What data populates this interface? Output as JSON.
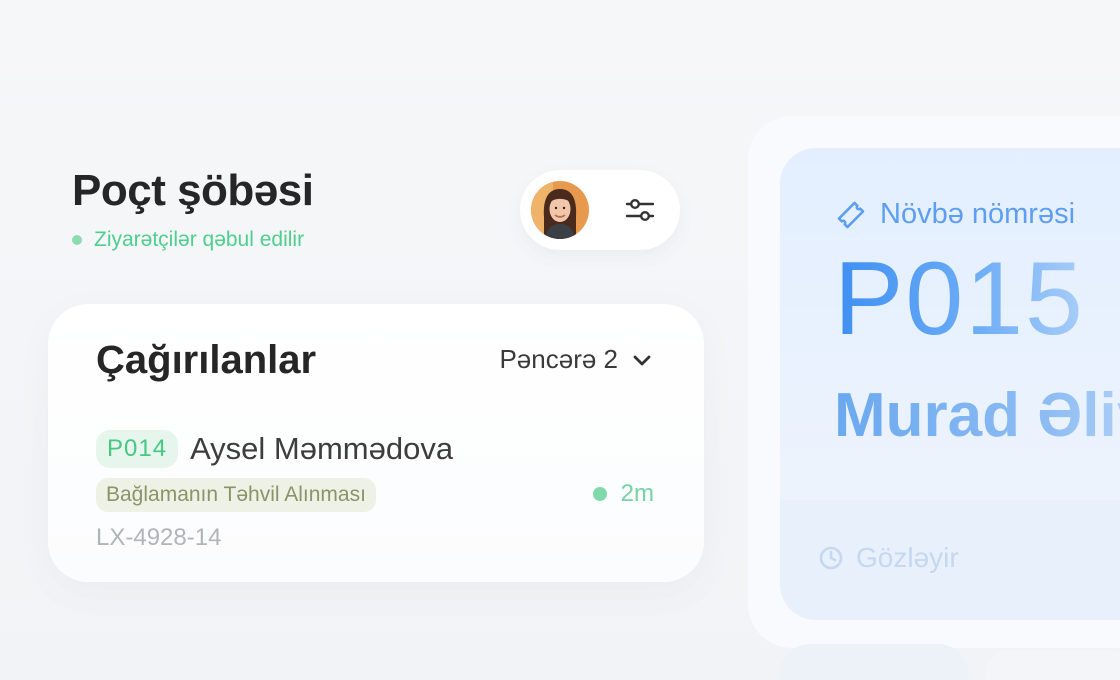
{
  "header": {
    "title": "Poçt şöbəsi",
    "status": "Ziyarətçilər qəbul edilir"
  },
  "profile": {
    "avatar_icon": "avatar",
    "filter_icon": "sliders-icon"
  },
  "called": {
    "title": "Çağırılanlar",
    "window": "Pəncərə 2",
    "ticket": {
      "number": "P014",
      "name": "Aysel Məmmədova",
      "service": "Bağlamanın Təhvil Alınması",
      "code": "LX-4928-14",
      "time": "2m"
    }
  },
  "queue": {
    "label": "Növbə nömrəsi",
    "number": "P015",
    "person": "Murad Əliyev",
    "status": "Gözləyir"
  },
  "colors": {
    "accent_green": "#4fcf8e",
    "accent_blue": "#3f8ff2"
  }
}
